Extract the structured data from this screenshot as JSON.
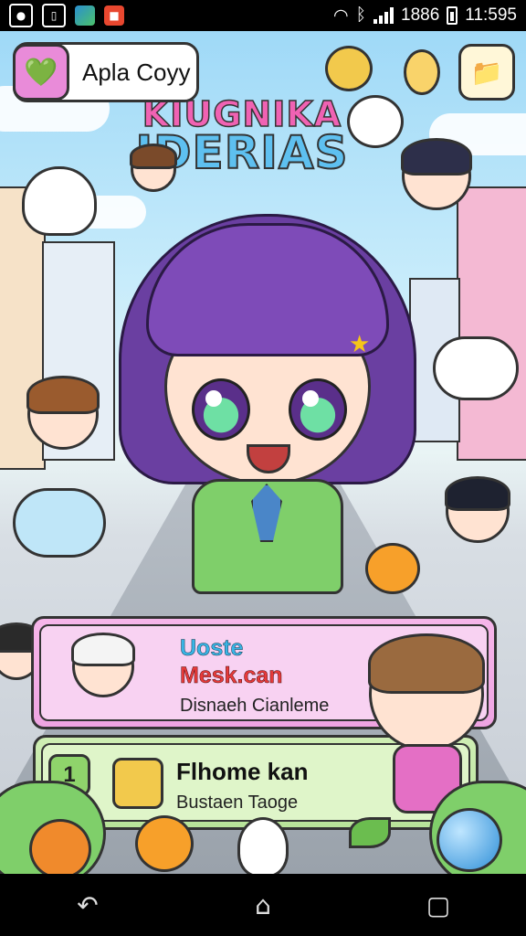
{
  "status_bar": {
    "time": "11:595",
    "battery_text": "1886",
    "icons": [
      "notification-icon",
      "sim-icon",
      "photo-icon",
      "app-notification-icon",
      "wifi-icon",
      "bluetooth-icon",
      "signal-icon",
      "battery-icon"
    ]
  },
  "header": {
    "profile_label": "Apla Coyy",
    "profile_icon": "heart-icon",
    "folder_icon": "folder-icon"
  },
  "logo": {
    "line1": "KIUGNIKA",
    "line2": "IDERIAS"
  },
  "cards": [
    {
      "title_line1": "Uoste",
      "title_line2": "Mesk.can",
      "subtitle": "Disnaeh Cianleme",
      "accent": "#f2a9e6"
    },
    {
      "badge": "1",
      "title": "Flhome kan",
      "subtitle": "Bustaen Taoge",
      "accent": "#bfe6a2"
    }
  ],
  "navbar": {
    "back": "back-icon",
    "home": "home-icon",
    "recents": "recents-icon"
  }
}
